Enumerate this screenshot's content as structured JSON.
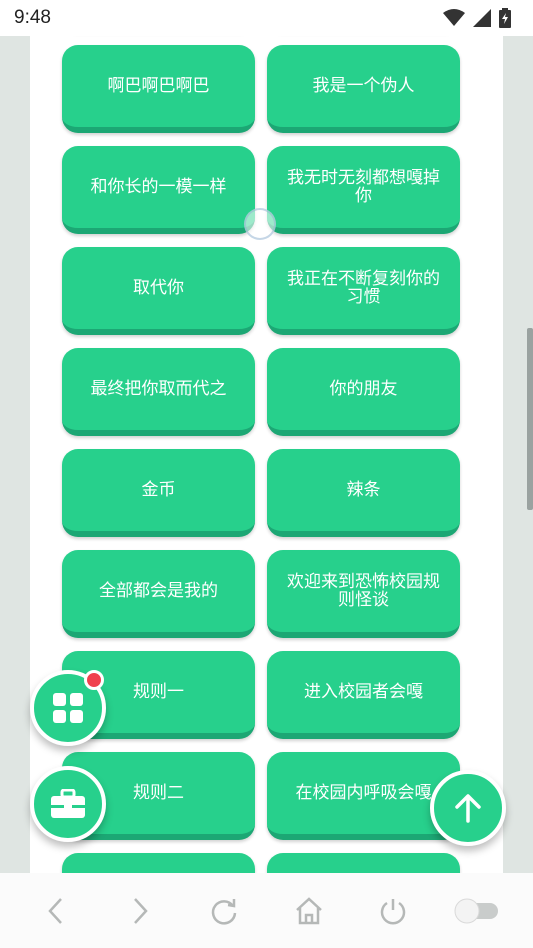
{
  "status": {
    "time": "9:48"
  },
  "buttons": [
    {
      "label": ""
    },
    {
      "label": ""
    },
    {
      "label": "啊巴啊巴啊巴"
    },
    {
      "label": "我是一个伪人"
    },
    {
      "label": "和你长的一模一样"
    },
    {
      "label": "我无时无刻都想嘎掉你"
    },
    {
      "label": "取代你"
    },
    {
      "label": "我正在不断复刻你的习惯"
    },
    {
      "label": "最终把你取而代之"
    },
    {
      "label": "你的朋友"
    },
    {
      "label": "金币"
    },
    {
      "label": "辣条"
    },
    {
      "label": "全部都会是我的"
    },
    {
      "label": "欢迎来到恐怖校园规则怪谈"
    },
    {
      "label": "规则一"
    },
    {
      "label": "进入校园者会嘎"
    },
    {
      "label": "规则二"
    },
    {
      "label": "在校园内呼吸会嘎"
    },
    {
      "label": ""
    },
    {
      "label": ""
    }
  ],
  "fabs": {
    "grid_icon": "apps-grid-icon",
    "toolbox_icon": "toolbox-icon",
    "up_icon": "arrow-up-icon",
    "badge_color": "#f0414e"
  },
  "bottom_nav": [
    "back-icon",
    "forward-icon",
    "refresh-icon",
    "home-icon",
    "power-icon",
    "toggle-icon"
  ],
  "colors": {
    "button": "#27d08c",
    "button_shadow": "#1ca774"
  }
}
